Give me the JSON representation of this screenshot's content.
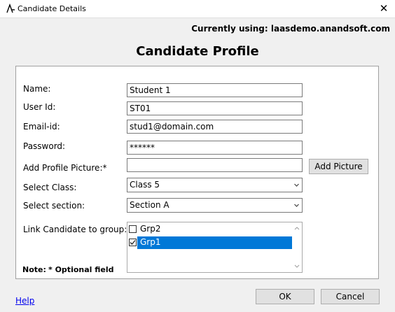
{
  "window": {
    "title": "Candidate Details",
    "close_glyph": "✕"
  },
  "currently_using": "Currently using: laasdemo.anandsoft.com",
  "heading": "Candidate Profile",
  "form": {
    "name_label": "Name:",
    "name_value": "Student 1",
    "userid_label": "User Id:",
    "userid_value": "ST01",
    "email_label": "Email-id:",
    "email_value": "stud1@domain.com",
    "password_label": "Password:",
    "password_value": "******",
    "picture_label": "Add Profile Picture:*",
    "picture_value": "",
    "add_picture_button": "Add Picture",
    "class_label": "Select Class:",
    "class_value": "Class 5",
    "section_label": "Select section:",
    "section_value": "Section A",
    "group_label": "Link Candidate to group:",
    "groups": [
      {
        "name": "Grp2",
        "checked": false,
        "selected": false
      },
      {
        "name": "Grp1",
        "checked": true,
        "selected": true
      }
    ],
    "note_label": "Note:",
    "note_text": "* Optional field"
  },
  "buttons": {
    "ok": "OK",
    "cancel": "Cancel"
  },
  "help_link": "Help",
  "colors": {
    "selection": "#0078d7",
    "link": "#0000ee"
  },
  "icons": {
    "app": "app-logo-icon",
    "close": "close-icon",
    "checkbox_checked": "checkmark-icon"
  }
}
